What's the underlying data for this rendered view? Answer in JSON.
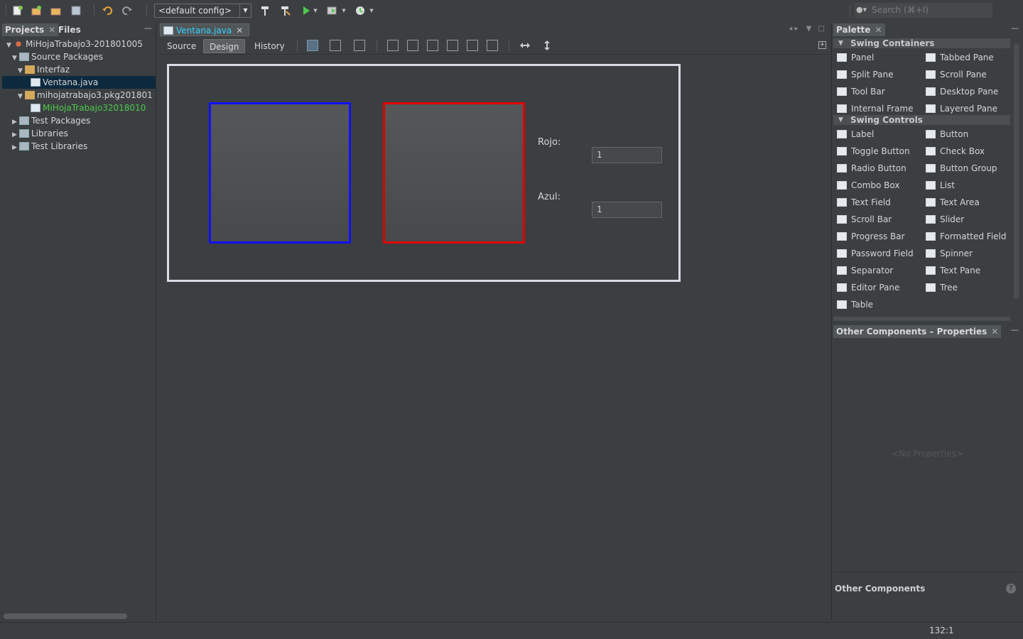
{
  "toolbar": {
    "config": "<default config>",
    "search_placeholder": "Search (⌘+I)"
  },
  "projects_panel": {
    "tabs": [
      {
        "label": "Projects"
      },
      {
        "label": "Files"
      }
    ],
    "tree": [
      {
        "label": "MiHojaTrabajo3-201801005",
        "level": 0,
        "expanded": true,
        "icon": "project-icon"
      },
      {
        "label": "Source Packages",
        "level": 1,
        "expanded": true,
        "icon": "source-packages-icon"
      },
      {
        "label": "Interfaz",
        "level": 2,
        "expanded": true,
        "icon": "package-icon"
      },
      {
        "label": "Ventana.java",
        "level": 3,
        "selected": true,
        "icon": "java-form-icon"
      },
      {
        "label": "mihojatrabajo3.pkg201801",
        "level": 2,
        "expanded": true,
        "icon": "package-icon"
      },
      {
        "label": "MiHojaTrabajo32018010",
        "level": 3,
        "icon": "java-file-icon",
        "color": "#4ec94e"
      },
      {
        "label": "Test Packages",
        "level": 1,
        "expanded": false,
        "icon": "test-packages-icon"
      },
      {
        "label": "Libraries",
        "level": 1,
        "expanded": false,
        "icon": "libraries-icon"
      },
      {
        "label": "Test Libraries",
        "level": 1,
        "expanded": false,
        "icon": "test-libraries-icon"
      }
    ]
  },
  "editor": {
    "file_tab": "Ventana.java",
    "views": [
      {
        "label": "Source"
      },
      {
        "label": "Design"
      },
      {
        "label": "History"
      }
    ],
    "active_view": "Design"
  },
  "form": {
    "panel_blue_color": "#1010ff",
    "panel_red_color": "#e00000",
    "rojo_label": "Rojo:",
    "rojo_value": "1",
    "azul_label": "Azul:",
    "azul_value": "1"
  },
  "palette": {
    "title": "Palette",
    "categories": [
      {
        "name": "Swing Containers",
        "items": [
          "Panel",
          "Tabbed Pane",
          "Split Pane",
          "Scroll Pane",
          "Tool Bar",
          "Desktop Pane",
          "Internal Frame",
          "Layered Pane"
        ]
      },
      {
        "name": "Swing Controls",
        "items": [
          "Label",
          "Button",
          "Toggle Button",
          "Check Box",
          "Radio Button",
          "Button Group",
          "Combo Box",
          "List",
          "Text Field",
          "Text Area",
          "Scroll Bar",
          "Slider",
          "Progress Bar",
          "Formatted Field",
          "Password Field",
          "Spinner",
          "Separator",
          "Text Pane",
          "Editor Pane",
          "Tree",
          "Table"
        ]
      }
    ]
  },
  "properties": {
    "title": "Other Components – Properties",
    "empty_text": "<No Properties>",
    "footer": "Other Components"
  },
  "status": {
    "caret": "132:1"
  }
}
